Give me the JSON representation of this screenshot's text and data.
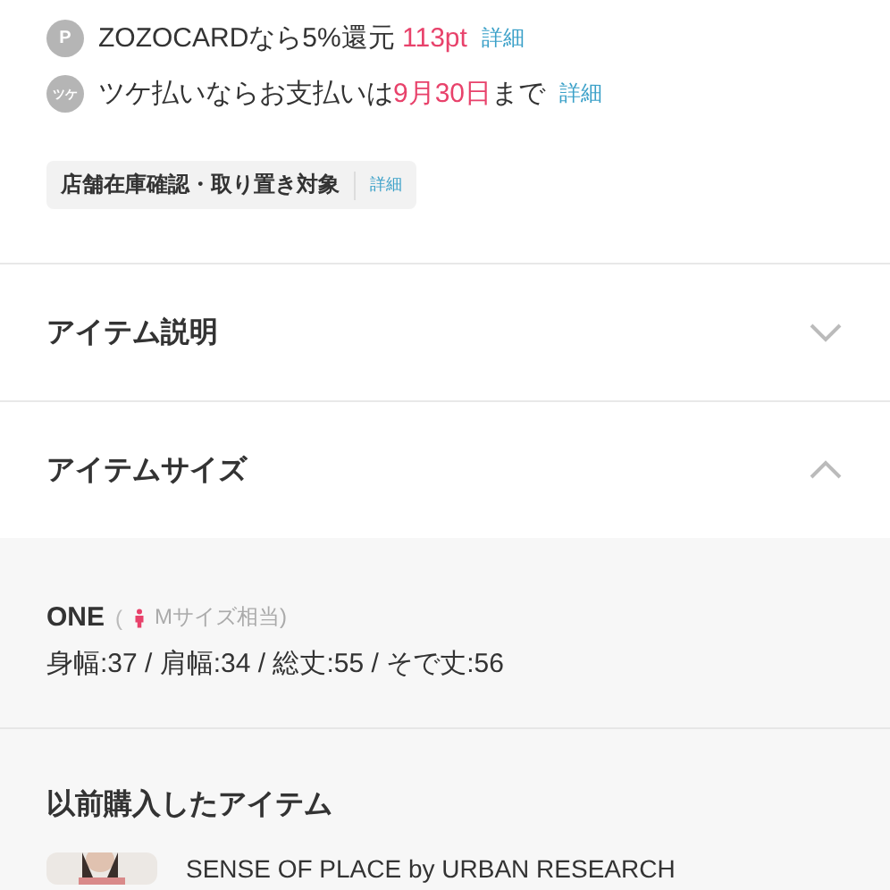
{
  "benefits": [
    {
      "icon_text": "P",
      "segments": [
        {
          "text": "ZOZOCARDなら5%還元 ",
          "accent": false
        },
        {
          "text": "113pt",
          "accent": true
        }
      ],
      "link": "詳細"
    },
    {
      "icon_text": "ツケ",
      "segments": [
        {
          "text": "ツケ払いならお支払いは",
          "accent": false
        },
        {
          "text": "9月30日",
          "accent": true
        },
        {
          "text": "まで",
          "accent": false
        }
      ],
      "link": "詳細"
    }
  ],
  "store_tag": {
    "label": "店舗在庫確認・取り置き対象",
    "link": "詳細"
  },
  "sections": [
    {
      "title": "アイテム説明",
      "expanded": false
    },
    {
      "title": "アイテムサイズ",
      "expanded": true
    }
  ],
  "size": {
    "name": "ONE",
    "note_open": "(",
    "note": "Mサイズ相当)",
    "measurements": "身幅:37 / 肩幅:34 / 総丈:55 / そで丈:56"
  },
  "history": {
    "title": "以前購入したアイテム",
    "items": [
      {
        "kind": "picture",
        "brand": "SENSE OF PLACE by URBAN RESEARCH"
      }
    ]
  }
}
